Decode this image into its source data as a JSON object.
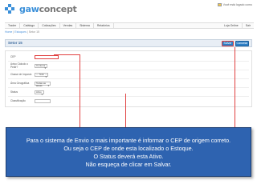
{
  "logo": {
    "brand": "gaw",
    "rest": "concept"
  },
  "user_link": "Você está logado como",
  "menu": {
    "left": [
      "Trader",
      "Catálogo",
      "Cotizações",
      "Vendas",
      "Sistema",
      "Relatórios"
    ],
    "right": [
      "Loja Online",
      "Sair"
    ]
  },
  "breadcrumb": [
    "Home",
    "Estoques",
    "Setor 15"
  ],
  "page": {
    "title": "Setor 15",
    "save_label": "Salvar",
    "cancel_label": "Cancelar"
  },
  "form": {
    "fields": [
      {
        "label": "CEP",
        "value": ""
      },
      {
        "label": "Aviso Cálculo o Pedir?",
        "value": "Contena"
      },
      {
        "label": "Classe de Imposto",
        "value": "--- Nulo ---"
      },
      {
        "label": "Área Geográfica",
        "value": "Todas as áreas"
      },
      {
        "label": "Status",
        "value": "Ativo"
      },
      {
        "label": "Classificação",
        "value": ""
      }
    ]
  },
  "callout": {
    "lines": [
      "Para o sistema de Envio o mais importante é informar o CEP de origem correto.",
      "Ou seja o CEP de onde esta localizado o Estoque.",
      "O Status deverá esta Ativo.",
      "Não esqueça de clicar em Salvar."
    ]
  },
  "colors": {
    "accent": "#2e63b0",
    "highlight": "#e04040",
    "brand": "#3a8fd9"
  }
}
